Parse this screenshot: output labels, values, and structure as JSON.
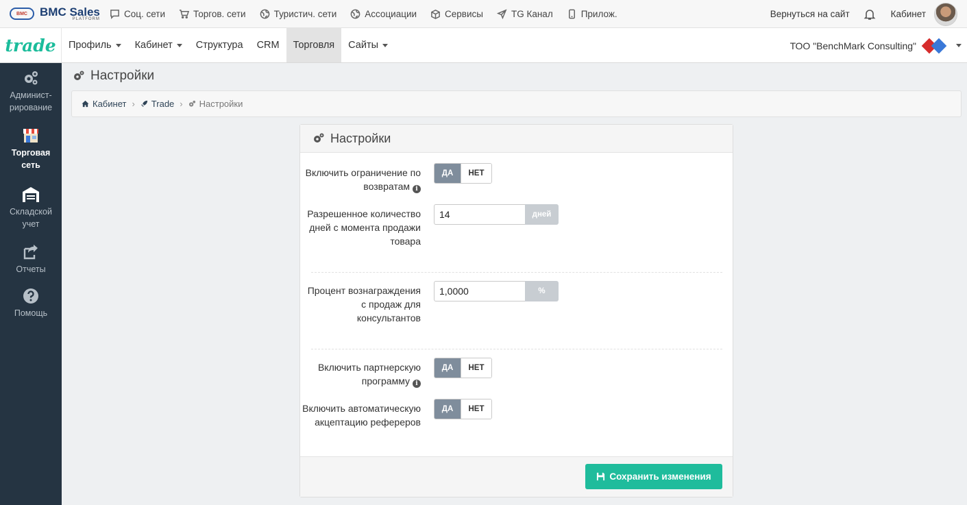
{
  "topbar": {
    "brand_name": "BMC Sales",
    "brand_sub": "PLATFORM",
    "brand_logo": "BMC",
    "links": [
      {
        "label": "Соц. сети",
        "icon": "chat-icon"
      },
      {
        "label": "Торгов. сети",
        "icon": "cart-icon"
      },
      {
        "label": "Туристич. сети",
        "icon": "globe-icon"
      },
      {
        "label": "Ассоциации",
        "icon": "globe-icon"
      },
      {
        "label": "Сервисы",
        "icon": "box-icon"
      },
      {
        "label": "TG Канал",
        "icon": "send-icon"
      },
      {
        "label": "Прилож.",
        "icon": "phone-icon"
      }
    ],
    "back_to_site": "Вернуться на сайт",
    "cabinet": "Кабинет"
  },
  "navbar": {
    "logo": "trade",
    "menu": [
      {
        "label": "Профиль",
        "dropdown": true,
        "active": false
      },
      {
        "label": "Кабинет",
        "dropdown": true,
        "active": false
      },
      {
        "label": "Структура",
        "dropdown": false,
        "active": false
      },
      {
        "label": "CRM",
        "dropdown": false,
        "active": false
      },
      {
        "label": "Торговля",
        "dropdown": false,
        "active": true
      },
      {
        "label": "Сайты",
        "dropdown": true,
        "active": false
      }
    ],
    "company": "ТОО \"BenchMark Consulting\"",
    "company_logo": "BMC"
  },
  "sidebar": {
    "items": [
      {
        "label": "Админист-рирование",
        "icon": "gears-icon",
        "active": false
      },
      {
        "label": "Торговая сеть",
        "icon": "store-icon",
        "active": true
      },
      {
        "label": "Складской учет",
        "icon": "warehouse-icon",
        "active": false
      },
      {
        "label": "Отчеты",
        "icon": "share-icon",
        "active": false
      },
      {
        "label": "Помощь",
        "icon": "help-icon",
        "active": false
      }
    ]
  },
  "page": {
    "title": "Настройки",
    "breadcrumb": [
      {
        "label": "Кабинет",
        "icon": "home-icon"
      },
      {
        "label": "Trade",
        "icon": "rocket-icon"
      },
      {
        "label": "Настройки",
        "icon": "gears-icon"
      }
    ]
  },
  "panel": {
    "title": "Настройки",
    "fields": {
      "returns_limit": {
        "label": "Включить ограничение по возвратам",
        "on": "ДА",
        "off": "НЕТ",
        "value": "ДА"
      },
      "allowed_days": {
        "label": "Разрешенное количество дней с момента продажи товара",
        "value": "14",
        "addon": "дней"
      },
      "reward_percent": {
        "label": "Процент вознаграждения с продаж для консультантов",
        "value": "1,0000",
        "addon": "%"
      },
      "partner_program": {
        "label": "Включить партнерскую программу",
        "on": "ДА",
        "off": "НЕТ",
        "value": "ДА"
      },
      "auto_accept": {
        "label": "Включить автоматическую акцептацию рефереров",
        "on": "ДА",
        "off": "НЕТ",
        "value": "ДА"
      }
    },
    "save_label": "Сохранить изменения"
  },
  "colors": {
    "accent": "#1fbc9c",
    "sidebar_bg": "#253442",
    "toggle_on": "#7f8d9c"
  }
}
